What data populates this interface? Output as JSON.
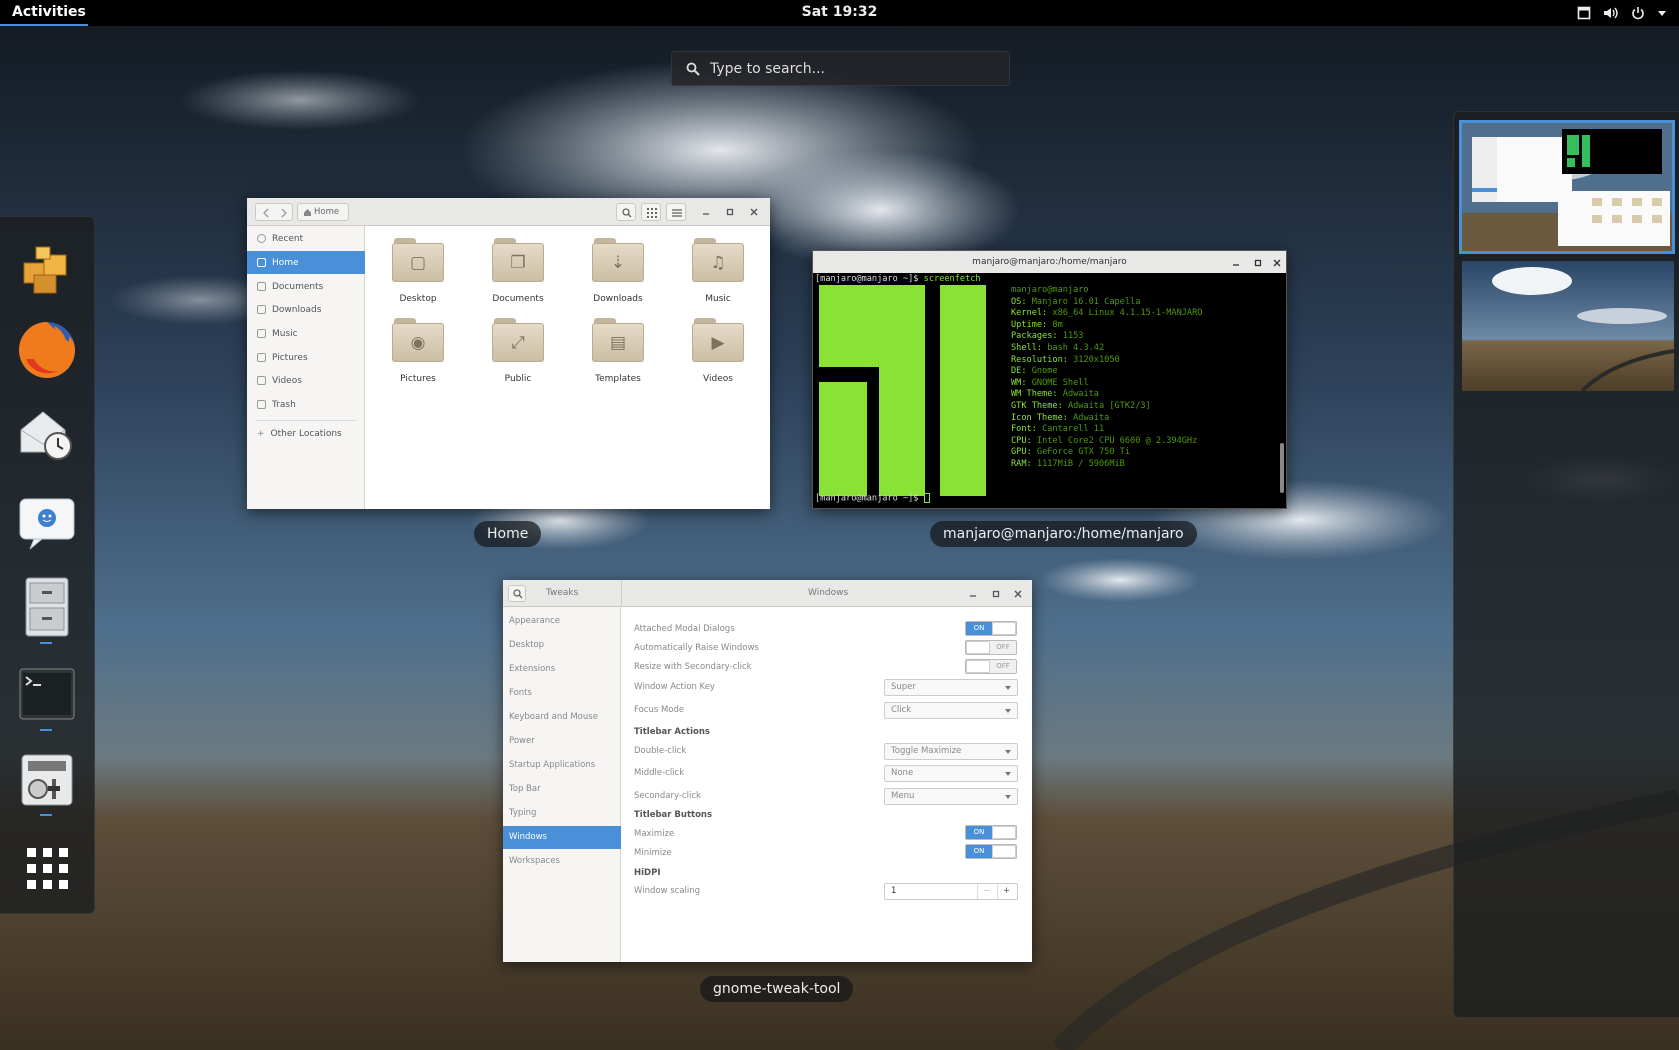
{
  "topbar": {
    "activities": "Activities",
    "clock": "Sat 19:32",
    "tray_icons": [
      "window-icon",
      "volume-icon",
      "power-icon",
      "menu-arrow-icon"
    ]
  },
  "search": {
    "placeholder": "Type to search..."
  },
  "dash": {
    "apps": [
      "packages",
      "firefox",
      "mail-clock",
      "chat",
      "file-cabinet",
      "terminal",
      "settings-tweaks",
      "show-applications"
    ]
  },
  "files_window": {
    "path_button": "Home",
    "sidebar": [
      "Recent",
      "Home",
      "Documents",
      "Downloads",
      "Music",
      "Pictures",
      "Videos",
      "Trash",
      "Other Locations"
    ],
    "folders": [
      {
        "label": "Desktop",
        "glyph": "▢"
      },
      {
        "label": "Documents",
        "glyph": "❐"
      },
      {
        "label": "Downloads",
        "glyph": "⇣"
      },
      {
        "label": "Music",
        "glyph": "♫"
      },
      {
        "label": "Pictures",
        "glyph": "◉"
      },
      {
        "label": "Public",
        "glyph": "⤢"
      },
      {
        "label": "Templates",
        "glyph": "▤"
      },
      {
        "label": "Videos",
        "glyph": "▶"
      }
    ],
    "caption": "Home"
  },
  "terminal": {
    "title": "manjaro@manjaro:/home/manjaro",
    "prompt": "[manjaro@manjaro ~]$",
    "command": "screenfetch",
    "user_host": "manjaro@manjaro",
    "info": [
      {
        "k": "OS:",
        "v": "Manjaro 16.01 Capella"
      },
      {
        "k": "Kernel:",
        "v": "x86_64 Linux 4.1.15-1-MANJARO"
      },
      {
        "k": "Uptime:",
        "v": "8m"
      },
      {
        "k": "Packages:",
        "v": "1153"
      },
      {
        "k": "Shell:",
        "v": "bash 4.3.42"
      },
      {
        "k": "Resolution:",
        "v": "3120x1050"
      },
      {
        "k": "DE:",
        "v": "Gnome"
      },
      {
        "k": "WM:",
        "v": "GNOME Shell"
      },
      {
        "k": "WM Theme:",
        "v": "Adwaita"
      },
      {
        "k": "GTK Theme:",
        "v": "Adwaita [GTK2/3]"
      },
      {
        "k": "Icon Theme:",
        "v": "Adwaita"
      },
      {
        "k": "Font:",
        "v": "Cantarell 11"
      },
      {
        "k": "CPU:",
        "v": "Intel Core2 CPU 6600 @ 2.394GHz"
      },
      {
        "k": "GPU:",
        "v": "GeForce GTX 750 Ti"
      },
      {
        "k": "RAM:",
        "v": "1117MiB / 5906MiB"
      }
    ],
    "caption": "manjaro@manjaro:/home/manjaro"
  },
  "tweaks": {
    "app_title": "Tweaks",
    "panel_title": "Windows",
    "sidebar": [
      "Appearance",
      "Desktop",
      "Extensions",
      "Fonts",
      "Keyboard and Mouse",
      "Power",
      "Startup Applications",
      "Top Bar",
      "Typing",
      "Windows",
      "Workspaces"
    ],
    "selected": "Windows",
    "rows": {
      "attached_modal": "Attached Modal Dialogs",
      "raise_windows": "Automatically Raise Windows",
      "resize_secondary": "Resize with Secondary-click",
      "action_key": "Window Action Key",
      "action_key_value": "Super",
      "focus_mode": "Focus Mode",
      "focus_mode_value": "Click",
      "titlebar_actions": "Titlebar Actions",
      "double_click": "Double-click",
      "double_click_value": "Toggle Maximize",
      "middle_click": "Middle-click",
      "middle_click_value": "None",
      "secondary_click": "Secondary-click",
      "secondary_click_value": "Menu",
      "titlebar_buttons": "Titlebar Buttons",
      "maximize": "Maximize",
      "minimize": "Minimize",
      "hidpi": "HiDPI",
      "window_scaling": "Window scaling",
      "window_scaling_value": "1",
      "on": "ON",
      "off": "OFF",
      "minus": "−",
      "plus": "+"
    },
    "caption": "gnome-tweak-tool"
  },
  "workspaces": {
    "count": 2,
    "active": 1
  },
  "colors": {
    "accent": "#4a90d9",
    "terminal_green": "#8ae234",
    "logo_green": "#35bf5c"
  }
}
